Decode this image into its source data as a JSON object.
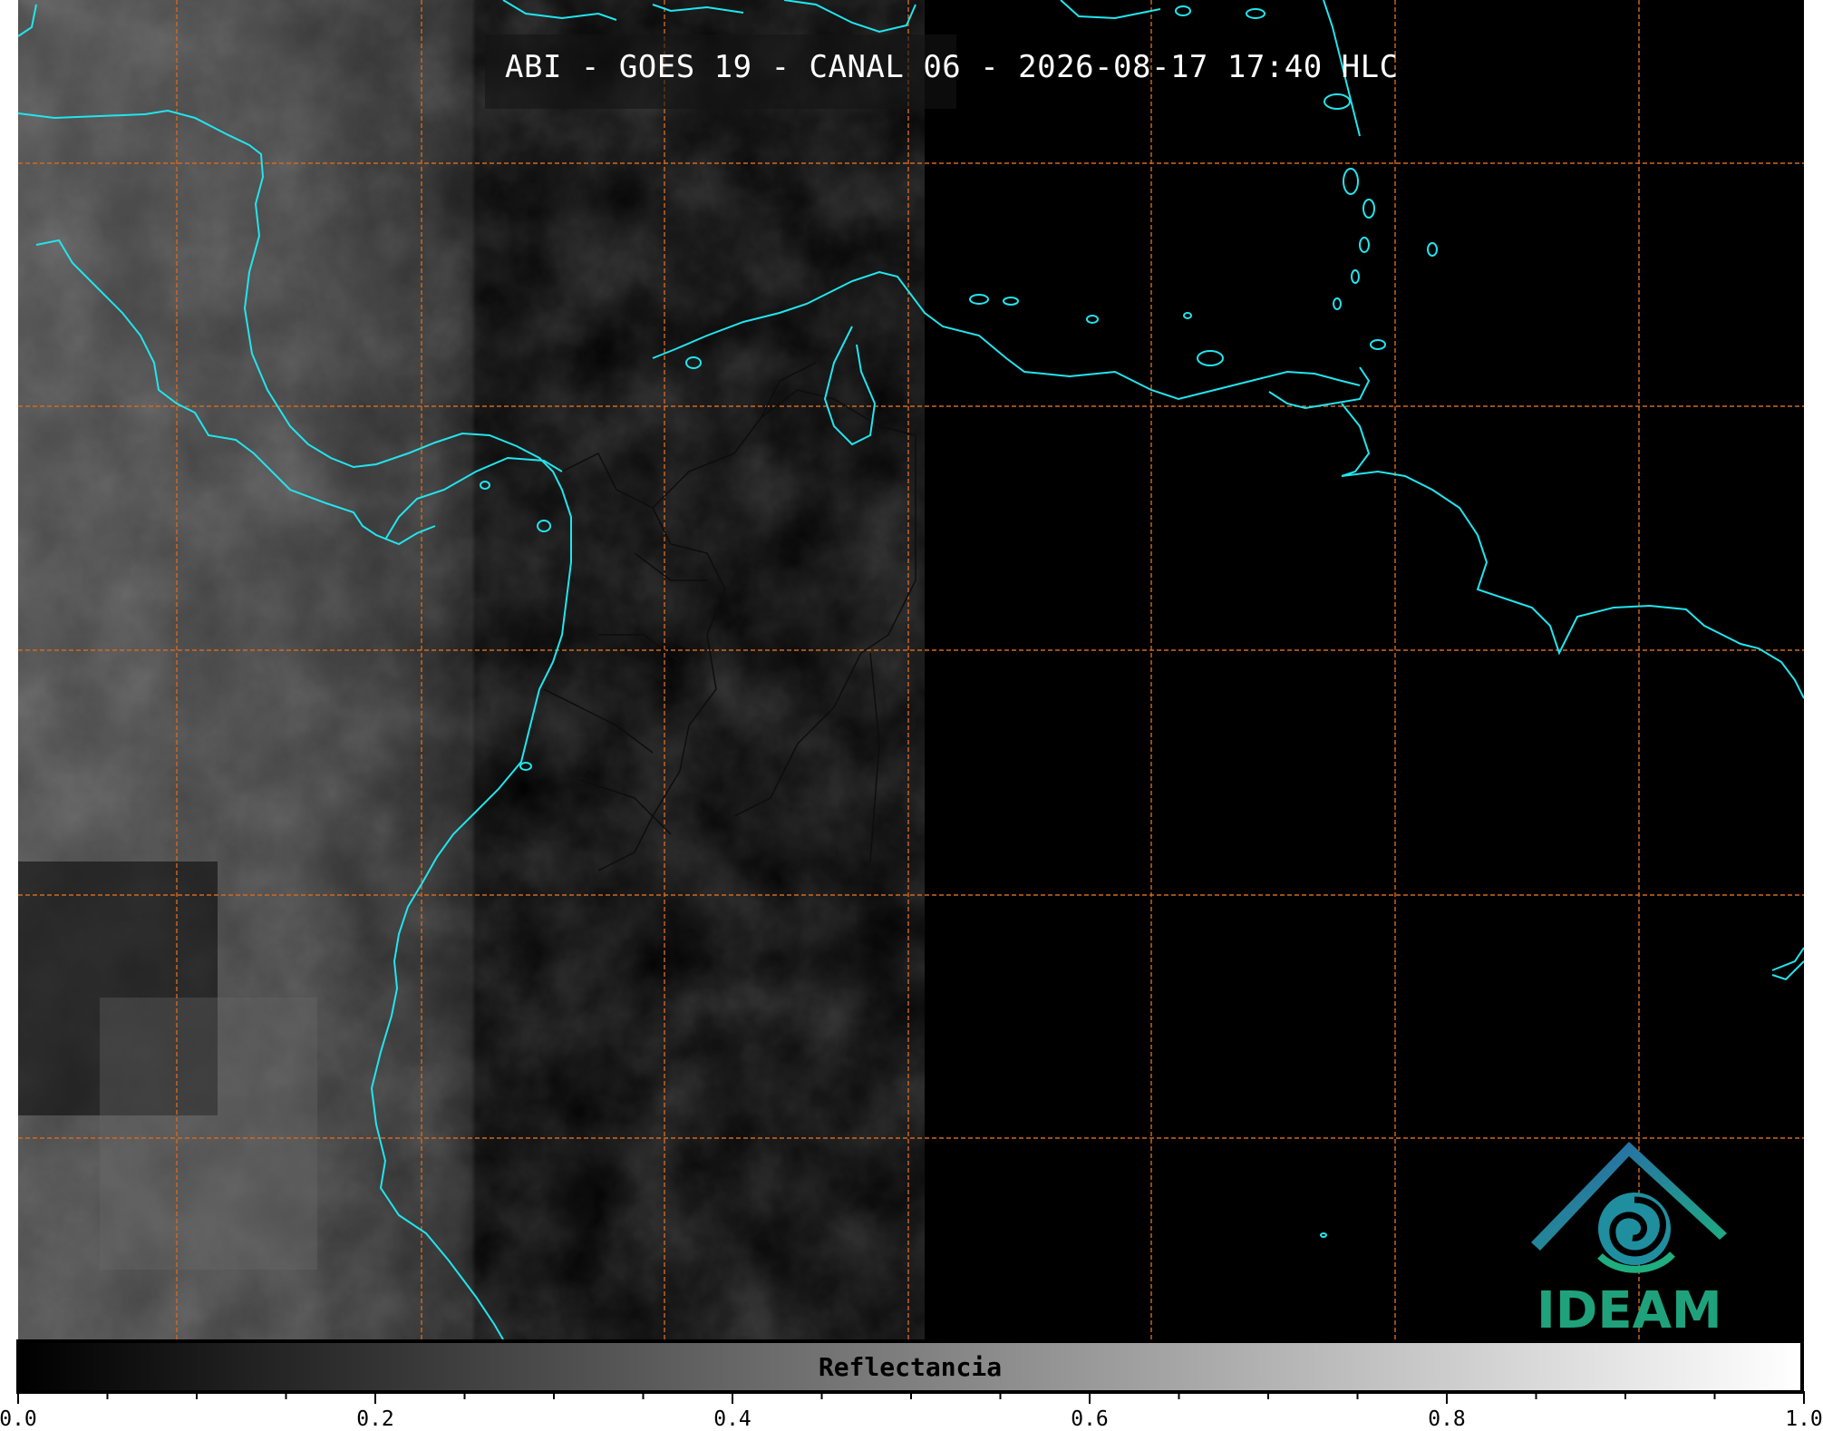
{
  "map": {
    "title": "ABI - GOES 19 - CANAL 06 - 2026-08-17 17:40 HLC",
    "colors": {
      "coastline": "#22e5ee",
      "gridlines": "#d2691e",
      "background": "#000000",
      "borders": "#111111"
    },
    "graticule": {
      "style": "dashed",
      "meridians": 7,
      "parallels": 5
    }
  },
  "logo": {
    "text": "IDEAM",
    "icon": "ideam-roof-spiral-icon",
    "colors": {
      "text": "#1fa27b",
      "roof_from": "#2a5fb0",
      "roof_to": "#1fae7f"
    }
  },
  "colorbar": {
    "label": "Reflectancia",
    "range": [
      0.0,
      1.0
    ],
    "gradient": [
      "#000000",
      "#ffffff"
    ],
    "tick_labels": [
      "0.0",
      "0.2",
      "0.4",
      "0.6",
      "0.8",
      "1.0"
    ],
    "tick_values": [
      0.0,
      0.2,
      0.4,
      0.6,
      0.8,
      1.0
    ]
  }
}
